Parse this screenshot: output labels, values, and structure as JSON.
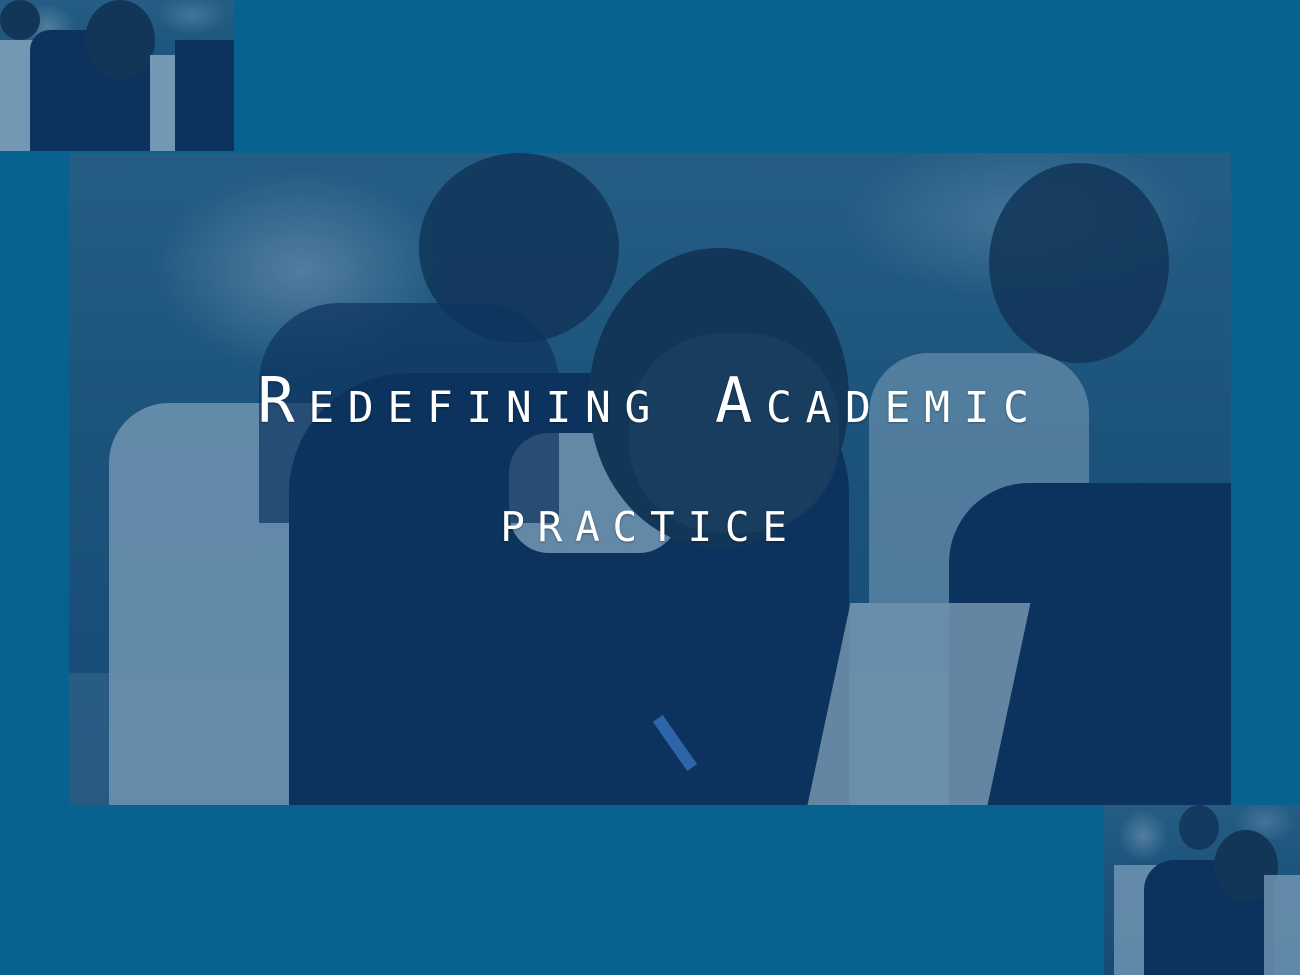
{
  "slide": {
    "background_color": "#07628f",
    "title_line_1": "Redefining Academic",
    "title_line_2": "practice"
  },
  "photos": {
    "main": "students-writing-photo",
    "corner_top_left": "students-writing-photo",
    "corner_bottom_right": "students-writing-photo"
  }
}
